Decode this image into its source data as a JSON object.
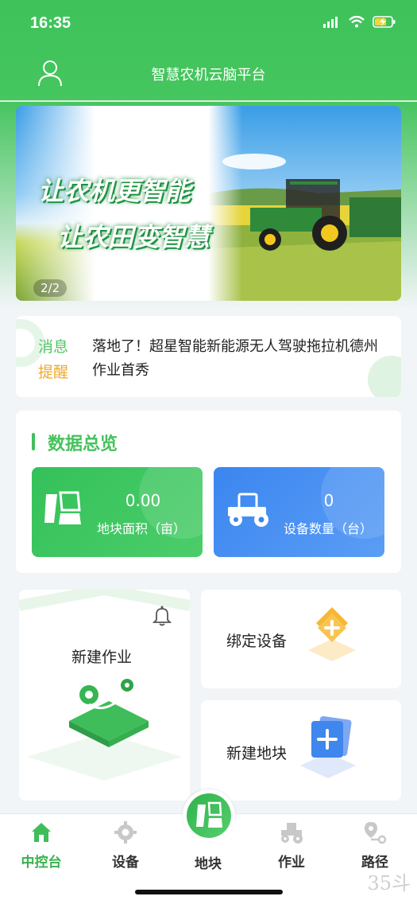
{
  "status_bar": {
    "time": "16:35"
  },
  "header": {
    "title": "智慧农机云脑平台"
  },
  "banner": {
    "slogan_line1": "让农机更智能",
    "slogan_line2": "让农田变智慧",
    "counter": "2/2"
  },
  "notice": {
    "tag_line1": "消息",
    "tag_line2": "提醒",
    "text": "落地了！超星智能新能源无人驾驶拖拉机德州作业首秀"
  },
  "overview": {
    "title": "数据总览",
    "stats": [
      {
        "value": "0.00",
        "label": "地块面积（亩）",
        "icon": "plot-icon"
      },
      {
        "value": "0",
        "label": "设备数量（台）",
        "icon": "tractor-icon"
      }
    ]
  },
  "actions": {
    "new_job": "新建作业",
    "bind_device": "绑定设备",
    "new_plot": "新建地块"
  },
  "tabbar": {
    "items": [
      {
        "label": "中控台",
        "icon": "home-icon",
        "active": true
      },
      {
        "label": "设备",
        "icon": "gear-icon"
      },
      {
        "label": "地块",
        "icon": "plot-icon"
      },
      {
        "label": "作业",
        "icon": "tractor-icon"
      },
      {
        "label": "路径",
        "icon": "route-icon"
      }
    ]
  },
  "watermark": "35斗",
  "colors": {
    "primary": "#45c65e",
    "blue": "#3b86f0",
    "orange": "#f0a82a"
  }
}
